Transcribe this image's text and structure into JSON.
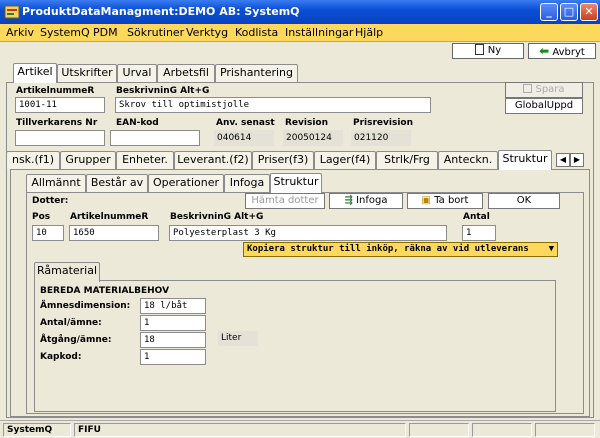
{
  "window": {
    "title": "ProduktDataManagment:DEMO AB: SystemQ"
  },
  "menu": [
    "Arkiv",
    "SystemQ",
    "PDM",
    "Sökrutiner",
    "Verktyg",
    "Kodlista",
    "Inställningar",
    "Hjälp"
  ],
  "toolbar": {
    "new_label": "Ny",
    "quit_label": "Avbryt"
  },
  "main_tabs": [
    "Artikel",
    "Utskrifter",
    "Urval",
    "Arbetsfil",
    "Prishantering"
  ],
  "header_form": {
    "article_number_label": "ArtikelnummeR",
    "article_number": "1001-11",
    "description_label": "BeskrivninG Alt+G",
    "description": "Skrov till optimistjolle",
    "manufacturer_no_label": "Tillverkarens Nr",
    "manufacturer_no": "",
    "ean_label": "EAN-kod",
    "ean": "",
    "last_used_label": "Anv. senast",
    "last_used": "040614",
    "revision_label": "Revision",
    "revision": "20050124",
    "price_revision_label": "Prisrevision",
    "price_revision": "021120",
    "save_label": "Spara",
    "global_update_label": "GlobalUppd"
  },
  "sub_tabs": [
    "nsk.(f1)",
    "Grupper",
    "Enheter.",
    "Leverant.(f2)",
    "Priser(f3)",
    "Lager(f4)",
    "Strlk/Frg",
    "Anteckn.",
    "Struktur"
  ],
  "inner_tabs": [
    "Allmännt",
    "Består av",
    "Operationer",
    "Infoga",
    "Struktur"
  ],
  "structure": {
    "dotter_label": "Dotter:",
    "fetch_daughter_label": "Hämta dotter",
    "insert_label": "Infoga",
    "delete_label": "Ta bort",
    "ok_label": "OK",
    "pos_label": "Pos",
    "pos": "10",
    "article_number_label": "ArtikelnummeR",
    "article_number": "1650",
    "description_label": "BeskrivninG Alt+G",
    "description": "Polyesterplast 3 Kg",
    "quantity_label": "Antal",
    "quantity": "1",
    "copy_option": "Kopiera struktur till inköp, räkna av vid utleverans"
  },
  "material": {
    "tab_label": "Råmaterial",
    "section_title": "BEREDA MATERIALBEHOV",
    "dimension_label": "Ämnesdimension:",
    "dimension": "18 l/båt",
    "count_label": "Antal/ämne:",
    "count": "1",
    "consumption_label": "Åtgång/ämne:",
    "consumption": "18",
    "unit": "Liter",
    "cut_code_label": "Kapkod:",
    "cut_code": "1"
  },
  "status": {
    "app": "SystemQ",
    "user": "FIFU"
  },
  "colors": {
    "titlebar": "#0a4fd6",
    "menubar": "#fcd95c",
    "option_bar": "#fcd95c"
  }
}
